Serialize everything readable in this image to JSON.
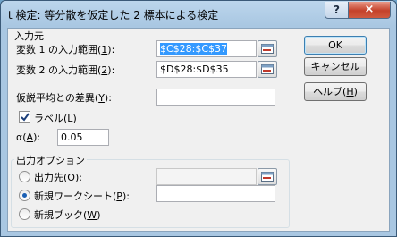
{
  "window": {
    "title": "t 検定: 等分散を仮定した 2 標本による検定",
    "help_label": "?",
    "close_label": "×"
  },
  "input_section": {
    "label": "入力元",
    "var1_label": "変数 1 の入力範囲(",
    "var1_key": "1",
    "var1_suffix": "):",
    "var1_value": "$C$28:$C$37",
    "var2_label": "変数 2 の入力範囲(",
    "var2_key": "2",
    "var2_suffix": "):",
    "var2_value": "$D$28:$D$35",
    "hypo_label": "仮説平均との差異(",
    "hypo_key": "Y",
    "hypo_suffix": "):",
    "hypo_value": "",
    "labels_label": "ラベル(",
    "labels_key": "L",
    "labels_suffix": ")",
    "labels_checked": true,
    "alpha_label": "α(",
    "alpha_key": "A",
    "alpha_suffix": "):",
    "alpha_value": "0.05"
  },
  "output_section": {
    "label": "出力オプション",
    "out_range_label": "出力先(",
    "out_range_key": "O",
    "out_range_suffix": "):",
    "new_sheet_label": "新規ワークシート(",
    "new_sheet_key": "P",
    "new_sheet_suffix": "):",
    "new_book_label": "新規ブック(",
    "new_book_key": "W",
    "new_book_suffix": ")",
    "selected": "new_sheet"
  },
  "buttons": {
    "ok": "OK",
    "cancel": "キャンセル",
    "help_prefix": "ヘルプ(",
    "help_key": "H",
    "help_suffix": ")"
  }
}
